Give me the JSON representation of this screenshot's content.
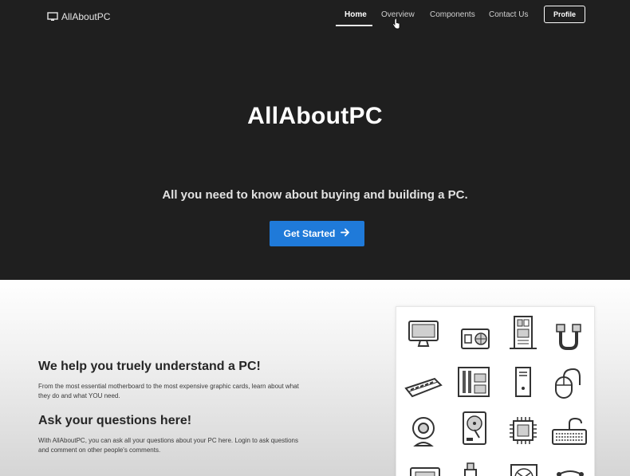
{
  "brand": {
    "name": "AllAboutPC",
    "icon": "monitor-icon"
  },
  "nav": {
    "links": [
      "Home",
      "Overview",
      "Components",
      "Contact Us"
    ],
    "active": "Home",
    "profile_label": "Profile"
  },
  "hero": {
    "title": "AllAboutPC",
    "subtitle": "All you need to know about buying and building a PC.",
    "cta_label": "Get Started",
    "cta_icon": "arrow-right-icon"
  },
  "features": [
    {
      "heading": "We help you truely understand a PC!",
      "text": "From the most essential motherboard to the most expensive graphic cards, learn about what they do and what YOU need."
    },
    {
      "heading": "Ask your questions here!",
      "text": "With AllAboutPC, you can ask all your questions about your PC here. Login to ask questions and comment on other people's comments."
    }
  ],
  "component_icons": [
    "monitor-icon",
    "power-supply-icon",
    "motherboard-icon",
    "sata-cable-icon",
    "ram-icon",
    "ram-slots-icon",
    "pc-tower-icon",
    "mouse-icon",
    "webcam-icon",
    "hard-drive-icon",
    "cpu-icon",
    "keyboard-icon",
    "ssd-icon",
    "usb-icon",
    "fan-icon",
    "cable-icon"
  ],
  "colors": {
    "hero_bg": "#1f1f1f",
    "cta": "#1f7ad9",
    "text_dark": "#262626"
  }
}
